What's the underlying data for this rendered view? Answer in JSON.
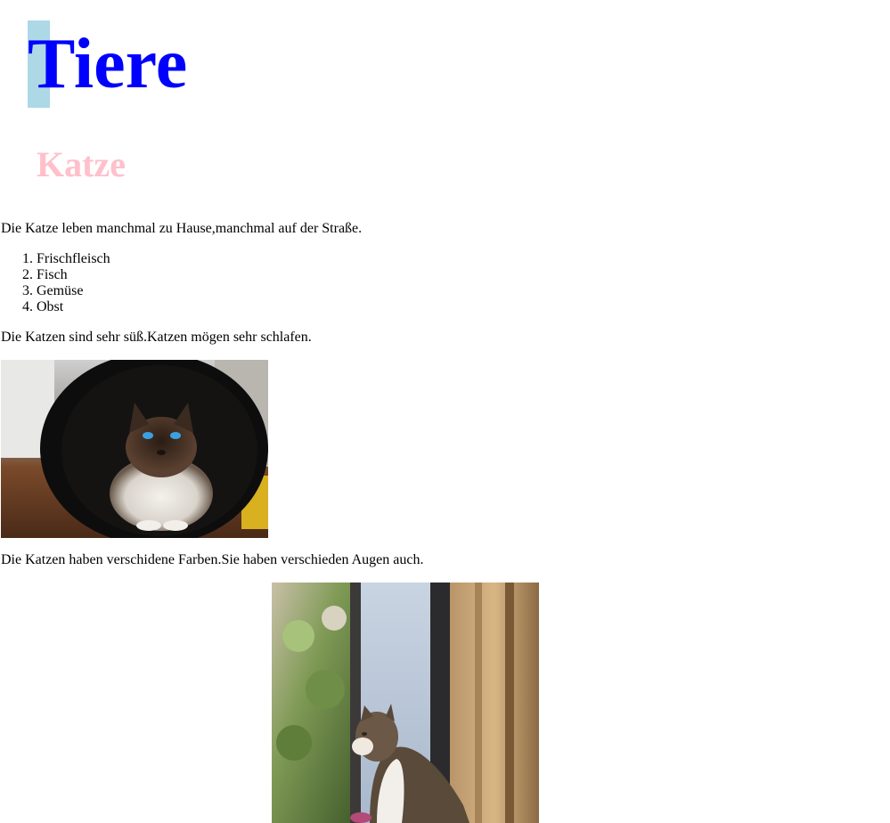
{
  "header": {
    "title": "Tiere",
    "subtitle": "Katze"
  },
  "content": {
    "paragraph1": "Die Katze leben manchmal zu Hause,manchmal auf der Straße.",
    "food_list": [
      {
        "number": "1.",
        "label": "Frischfleisch"
      },
      {
        "number": "2.",
        "label": "Fisch"
      },
      {
        "number": "3.",
        "label": "Gemüse"
      },
      {
        "number": "4.",
        "label": "Obst"
      }
    ],
    "paragraph2": "Die Katzen sind sehr süß.Katzen mögen sehr schlafen.",
    "paragraph3": "Die Katzen haben verschidene Farben.Sie haben verschieden Augen auch."
  },
  "colors": {
    "title": "#0000ff",
    "title_highlight": "#add8e6",
    "subtitle": "#ffc0cb"
  },
  "images": [
    {
      "name": "cat-in-tunnel-photo"
    },
    {
      "name": "cat-at-window-photo"
    }
  ]
}
